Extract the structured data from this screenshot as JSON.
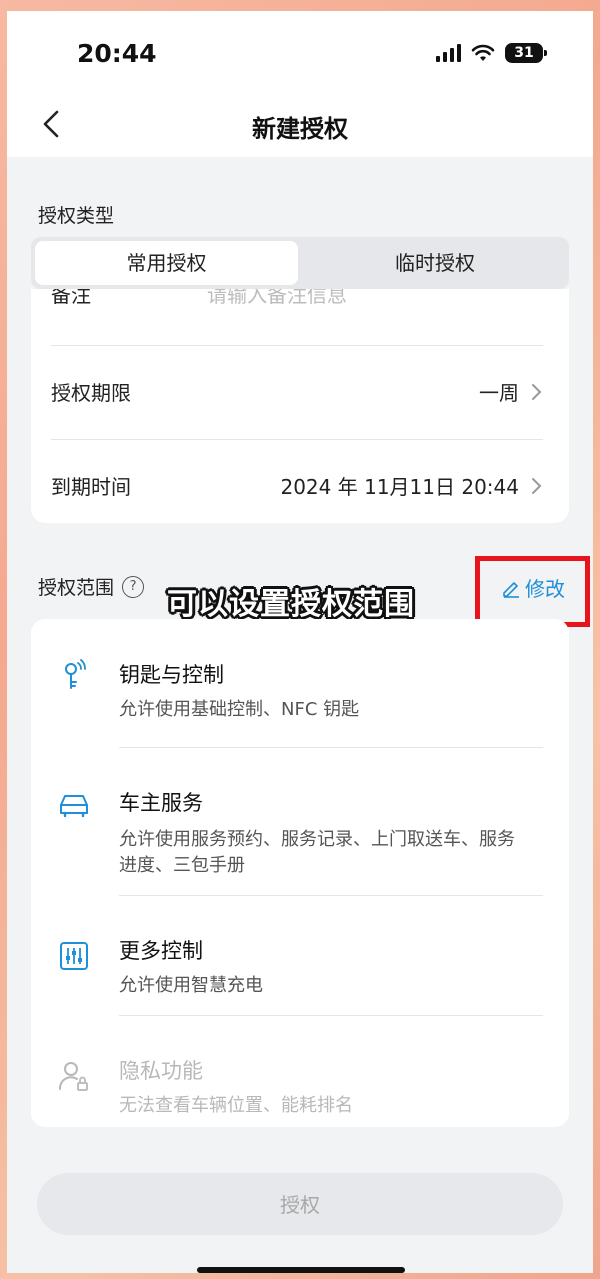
{
  "status_bar": {
    "time": "20:44",
    "battery": "31"
  },
  "nav": {
    "title": "新建授权"
  },
  "type_section": {
    "title": "授权类型",
    "tabs": [
      {
        "label": "常用授权",
        "active": true
      },
      {
        "label": "临时授权",
        "active": false
      }
    ]
  },
  "form": {
    "remark": {
      "label": "备注",
      "placeholder": "请输入备注信息"
    },
    "period": {
      "label": "授权期限",
      "value": "一周"
    },
    "expire": {
      "label": "到期时间",
      "value": "2024 年 11月11日 20:44"
    }
  },
  "scope": {
    "title": "授权范围",
    "help_glyph": "?",
    "edit_label": "修改",
    "overlay_caption": "可以设置授权范围",
    "highlight_color": "#e8141b",
    "accent_color": "#1e8fd8",
    "items": [
      {
        "title": "钥匙与控制",
        "desc": "允许使用基础控制、NFC 钥匙",
        "icon": "key-icon",
        "enabled": true
      },
      {
        "title": "车主服务",
        "desc": "允许使用服务预约、服务记录、上门取送车、服务进度、三包手册",
        "icon": "car-icon",
        "enabled": true
      },
      {
        "title": "更多控制",
        "desc": "允许使用智慧充电",
        "icon": "sliders-icon",
        "enabled": true
      },
      {
        "title": "隐私功能",
        "desc": "无法查看车辆位置、能耗排名",
        "icon": "user-lock-icon",
        "enabled": false
      }
    ]
  },
  "submit": {
    "label": "授权"
  }
}
